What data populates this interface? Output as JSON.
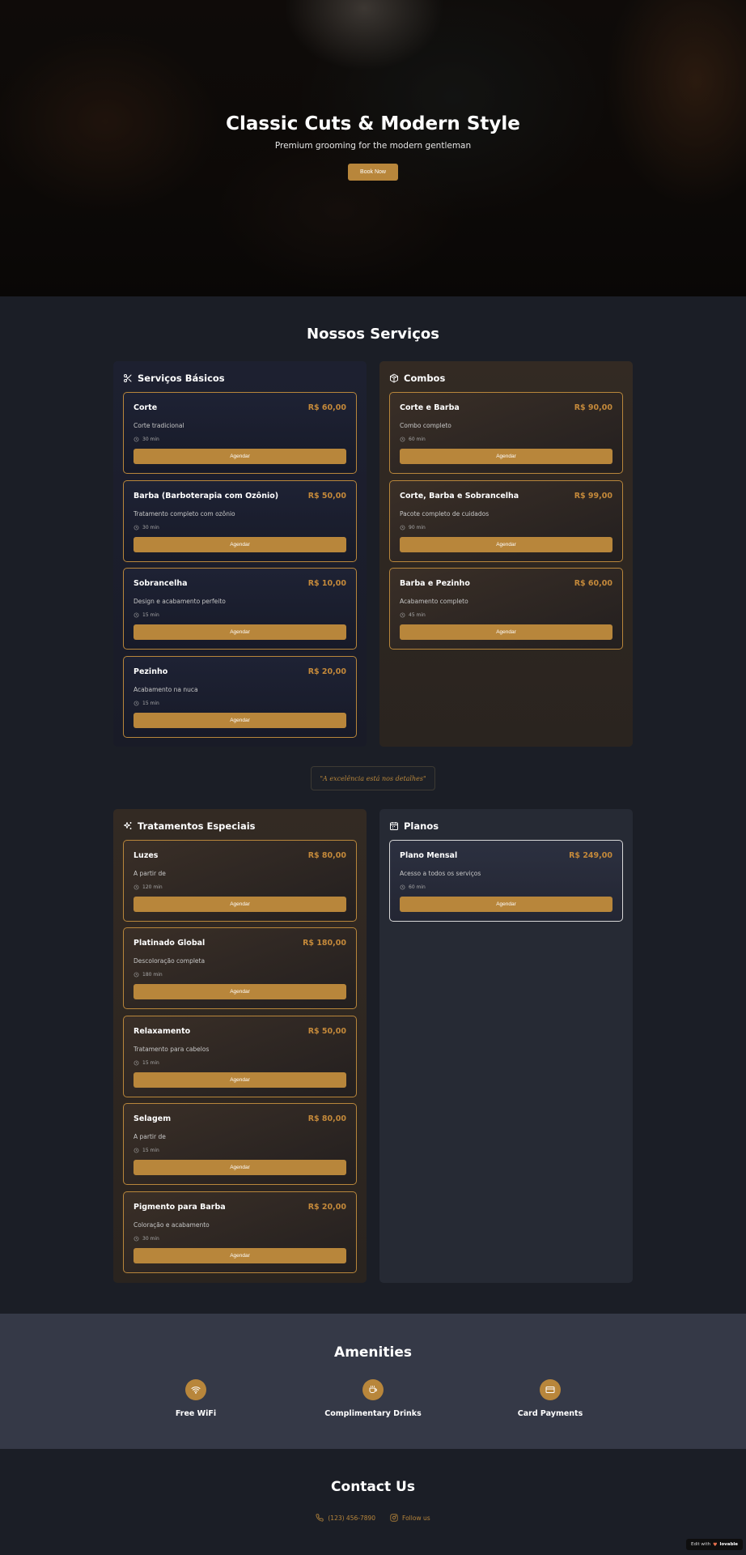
{
  "hero": {
    "title": "Classic Cuts & Modern Style",
    "subtitle": "Premium grooming for the modern gentleman",
    "cta": "Book Now"
  },
  "services": {
    "title": "Nossos Serviços",
    "book_label": "Agendar",
    "basicos": {
      "title": "Serviços Básicos",
      "icon": "scissors-icon",
      "items": [
        {
          "name": "Corte",
          "price": "R$ 60,00",
          "desc": "Corte tradicional",
          "duration": "30 min"
        },
        {
          "name": "Barba (Barboterapia com Ozônio)",
          "price": "R$ 50,00",
          "desc": "Tratamento completo com ozônio",
          "duration": "30 min"
        },
        {
          "name": "Sobrancelha",
          "price": "R$ 10,00",
          "desc": "Design e acabamento perfeito",
          "duration": "15 min"
        },
        {
          "name": "Pezinho",
          "price": "R$ 20,00",
          "desc": "Acabamento na nuca",
          "duration": "15 min"
        }
      ]
    },
    "combos": {
      "title": "Combos",
      "icon": "package-icon",
      "items": [
        {
          "name": "Corte e Barba",
          "price": "R$ 90,00",
          "desc": "Combo completo",
          "duration": "60 min"
        },
        {
          "name": "Corte, Barba e Sobrancelha",
          "price": "R$ 99,00",
          "desc": "Pacote completo de cuidados",
          "duration": "90 min"
        },
        {
          "name": "Barba e Pezinho",
          "price": "R$ 60,00",
          "desc": "Acabamento completo",
          "duration": "45 min"
        }
      ]
    },
    "quote": "\"A excelência está nos detalhes\"",
    "tratamentos": {
      "title": "Tratamentos Especiais",
      "icon": "sparkles-icon",
      "items": [
        {
          "name": "Luzes",
          "price": "R$ 80,00",
          "desc": "A partir de",
          "duration": "120 min"
        },
        {
          "name": "Platinado Global",
          "price": "R$ 180,00",
          "desc": "Descoloração completa",
          "duration": "180 min"
        },
        {
          "name": "Relaxamento",
          "price": "R$ 50,00",
          "desc": "Tratamento para cabelos",
          "duration": "15 min"
        },
        {
          "name": "Selagem",
          "price": "R$ 80,00",
          "desc": "A partir de",
          "duration": "15 min"
        },
        {
          "name": "Pigmento para Barba",
          "price": "R$ 20,00",
          "desc": "Coloração e acabamento",
          "duration": "30 min"
        }
      ]
    },
    "planos": {
      "title": "Planos",
      "icon": "calendar-icon",
      "items": [
        {
          "name": "Plano Mensal",
          "price": "R$ 249,00",
          "desc": "Acesso a todos os serviços",
          "duration": "60 min"
        }
      ]
    }
  },
  "amenities": {
    "title": "Amenities",
    "items": [
      {
        "label": "Free WiFi",
        "icon": "wifi-icon"
      },
      {
        "label": "Complimentary Drinks",
        "icon": "coffee-icon"
      },
      {
        "label": "Card Payments",
        "icon": "credit-card-icon"
      }
    ]
  },
  "contact": {
    "title": "Contact Us",
    "phone": "(123) 456-7890",
    "social": "Follow us"
  },
  "badge": {
    "prefix": "Edit with",
    "brand": "lovable"
  },
  "colors": {
    "accent": "#b8863b",
    "background": "#1b1e26",
    "amenities_bg": "#353947"
  }
}
